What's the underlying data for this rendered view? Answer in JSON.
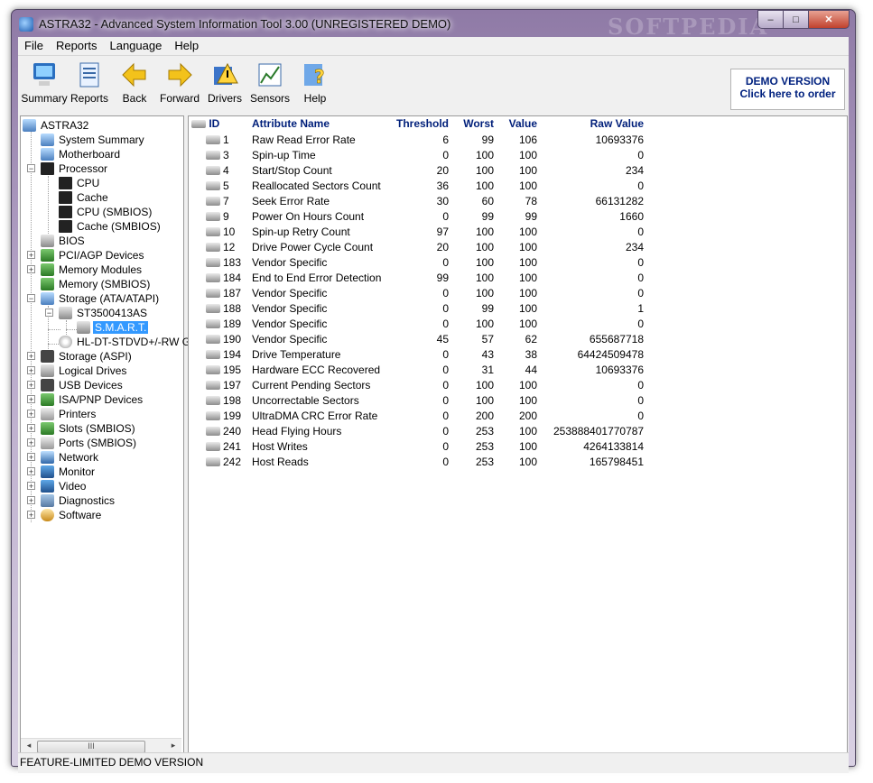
{
  "window": {
    "title": "ASTRA32 - Advanced System Information Tool 3.00 (UNREGISTERED DEMO)",
    "watermark": "SOFTPEDIA",
    "controls": [
      "–",
      "□",
      "✕"
    ]
  },
  "menu": [
    "File",
    "Reports",
    "Language",
    "Help"
  ],
  "toolbar": [
    {
      "label": "Summary",
      "icon": "summary-icon"
    },
    {
      "label": "Reports",
      "icon": "reports-icon"
    },
    {
      "label": "Back",
      "icon": "back-arrow-icon"
    },
    {
      "label": "Forward",
      "icon": "forward-arrow-icon"
    },
    {
      "label": "Drivers",
      "icon": "drivers-icon"
    },
    {
      "label": "Sensors",
      "icon": "sensors-icon"
    },
    {
      "label": "Help",
      "icon": "help-icon"
    }
  ],
  "demo_badge": {
    "line1": "DEMO VERSION",
    "line2": "Click here to order"
  },
  "tree": [
    {
      "label": "ASTRA32",
      "icon": "computer-icon"
    },
    {
      "label": "System Summary",
      "icon": "computer-icon"
    },
    {
      "label": "Motherboard",
      "icon": "motherboard-icon"
    },
    {
      "label": "Processor",
      "icon": "chip-icon"
    },
    {
      "label": "CPU",
      "icon": "chip-icon"
    },
    {
      "label": "Cache",
      "icon": "chip-icon"
    },
    {
      "label": "CPU (SMBIOS)",
      "icon": "chip-icon"
    },
    {
      "label": "Cache (SMBIOS)",
      "icon": "chip-icon"
    },
    {
      "label": "BIOS",
      "icon": "bios-chip-icon"
    },
    {
      "label": "PCI/AGP Devices",
      "icon": "card-icon"
    },
    {
      "label": "Memory Modules",
      "icon": "memory-icon"
    },
    {
      "label": "Memory (SMBIOS)",
      "icon": "memory-icon"
    },
    {
      "label": "Storage (ATA/ATAPI)",
      "icon": "storage-icon"
    },
    {
      "label": "ST3500413AS",
      "icon": "hard-drive-icon"
    },
    {
      "label": "S.M.A.R.T.",
      "icon": "hard-drive-icon"
    },
    {
      "label": "HL-DT-STDVD+/-RW G",
      "icon": "cd-drive-icon"
    },
    {
      "label": "Storage (ASPI)",
      "icon": "storage-icon"
    },
    {
      "label": "Logical Drives",
      "icon": "drives-icon"
    },
    {
      "label": "USB Devices",
      "icon": "usb-icon"
    },
    {
      "label": "ISA/PNP Devices",
      "icon": "card-icon"
    },
    {
      "label": "Printers",
      "icon": "printer-icon"
    },
    {
      "label": "Slots (SMBIOS)",
      "icon": "card-icon"
    },
    {
      "label": "Ports (SMBIOS)",
      "icon": "port-icon"
    },
    {
      "label": "Network",
      "icon": "network-icon"
    },
    {
      "label": "Monitor",
      "icon": "monitor-icon"
    },
    {
      "label": "Video",
      "icon": "video-icon"
    },
    {
      "label": "Diagnostics",
      "icon": "diagnostics-icon"
    },
    {
      "label": "Software",
      "icon": "software-icon"
    }
  ],
  "table": {
    "headers": [
      "ID",
      "Attribute Name",
      "Threshold",
      "Worst",
      "Value",
      "Raw Value"
    ],
    "rows": [
      [
        "1",
        "Raw Read Error Rate",
        "6",
        "99",
        "106",
        "10693376"
      ],
      [
        "3",
        "Spin-up Time",
        "0",
        "100",
        "100",
        "0"
      ],
      [
        "4",
        "Start/Stop Count",
        "20",
        "100",
        "100",
        "234"
      ],
      [
        "5",
        "Reallocated Sectors Count",
        "36",
        "100",
        "100",
        "0"
      ],
      [
        "7",
        "Seek Error Rate",
        "30",
        "60",
        "78",
        "66131282"
      ],
      [
        "9",
        "Power On Hours Count",
        "0",
        "99",
        "99",
        "1660"
      ],
      [
        "10",
        "Spin-up Retry Count",
        "97",
        "100",
        "100",
        "0"
      ],
      [
        "12",
        "Drive Power Cycle Count",
        "20",
        "100",
        "100",
        "234"
      ],
      [
        "183",
        "Vendor Specific",
        "0",
        "100",
        "100",
        "0"
      ],
      [
        "184",
        "End to End Error Detection",
        "99",
        "100",
        "100",
        "0"
      ],
      [
        "187",
        "Vendor Specific",
        "0",
        "100",
        "100",
        "0"
      ],
      [
        "188",
        "Vendor Specific",
        "0",
        "99",
        "100",
        "1"
      ],
      [
        "189",
        "Vendor Specific",
        "0",
        "100",
        "100",
        "0"
      ],
      [
        "190",
        "Vendor Specific",
        "45",
        "57",
        "62",
        "655687718"
      ],
      [
        "194",
        "Drive Temperature",
        "0",
        "43",
        "38",
        "64424509478"
      ],
      [
        "195",
        "Hardware ECC Recovered",
        "0",
        "31",
        "44",
        "10693376"
      ],
      [
        "197",
        "Current Pending Sectors",
        "0",
        "100",
        "100",
        "0"
      ],
      [
        "198",
        "Uncorrectable Sectors",
        "0",
        "100",
        "100",
        "0"
      ],
      [
        "199",
        "UltraDMA CRC Error Rate",
        "0",
        "200",
        "200",
        "0"
      ],
      [
        "240",
        "Head Flying Hours",
        "0",
        "253",
        "100",
        "253888401770787"
      ],
      [
        "241",
        "Host Writes",
        "0",
        "253",
        "100",
        "4264133814"
      ],
      [
        "242",
        "Host Reads",
        "0",
        "253",
        "100",
        "165798451"
      ]
    ]
  },
  "scrollbar": {
    "thumb_grip": "III",
    "left_arrow": "◂",
    "right_arrow": "▸"
  },
  "status": "FEATURE-LIMITED DEMO VERSION"
}
